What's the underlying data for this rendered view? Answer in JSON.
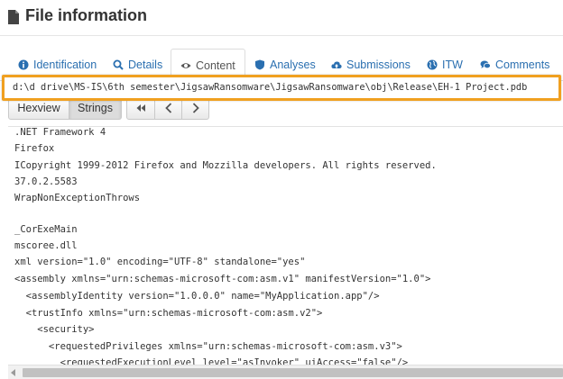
{
  "header": {
    "title": "File information"
  },
  "tabs": [
    {
      "label": "Identification",
      "icon": "info-circle-icon"
    },
    {
      "label": "Details",
      "icon": "magnifier-icon"
    },
    {
      "label": "Content",
      "icon": "eye-icon",
      "active": true
    },
    {
      "label": "Analyses",
      "icon": "shield-icon"
    },
    {
      "label": "Submissions",
      "icon": "cloud-upload-icon"
    },
    {
      "label": "ITW",
      "icon": "globe-icon"
    },
    {
      "label": "Comments",
      "icon": "comments-icon"
    }
  ],
  "toolbar": {
    "hexview_label": "Hexview",
    "strings_label": "Strings",
    "nav": [
      "first-page-icon",
      "previous-page-icon",
      "next-page-icon"
    ]
  },
  "content": {
    "lines_before": [
      ".NET Framework 4",
      "Firefox",
      "ICopyright 1999-2012 Firefox and Mozzilla developers. All rights reserved.",
      "37.0.2.5583",
      "WrapNonExceptionThrows"
    ],
    "highlighted": "d:\\d drive\\MS-IS\\6th semester\\JigsawRansomware\\JigsawRansomware\\obj\\Release\\EH-1 Project.pdb",
    "lines_after": [
      "_CorExeMain",
      "mscoree.dll",
      "xml version=\"1.0\" encoding=\"UTF-8\" standalone=\"yes\"",
      "<assembly xmlns=\"urn:schemas-microsoft-com:asm.v1\" manifestVersion=\"1.0\">",
      "  <assemblyIdentity version=\"1.0.0.0\" name=\"MyApplication.app\"/>",
      "  <trustInfo xmlns=\"urn:schemas-microsoft-com:asm.v2\">",
      "    <security>",
      "      <requestedPrivileges xmlns=\"urn:schemas-microsoft-com:asm.v3\">",
      "        <requestedExecutionLevel level=\"asInvoker\" uiAccess=\"false\"/>"
    ]
  },
  "colors": {
    "link": "#2a6fb0",
    "highlight_border": "#f0a020"
  }
}
